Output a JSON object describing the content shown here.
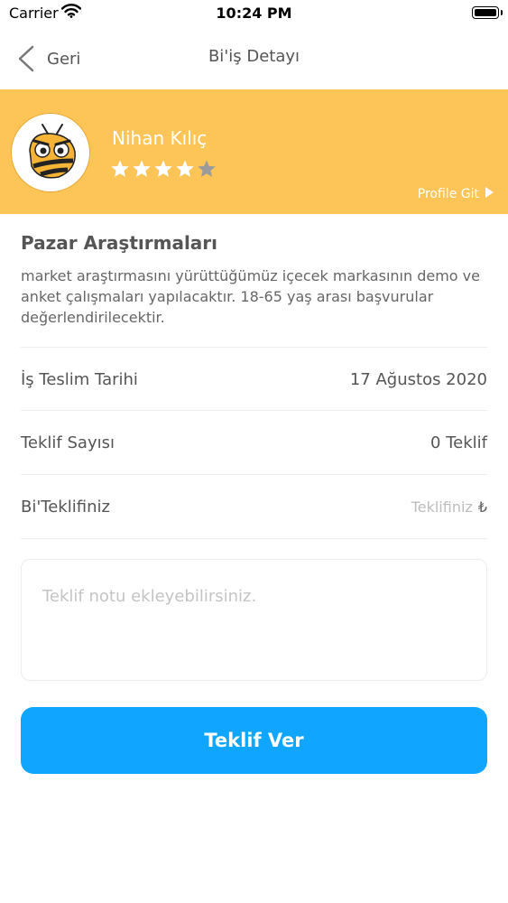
{
  "status_bar": {
    "carrier": "Carrier",
    "time": "10:24 PM"
  },
  "nav": {
    "back_label": "Geri",
    "title": "Bi'iş Detayı"
  },
  "profile": {
    "name": "Nihan Kılıç",
    "rating": 4,
    "rating_max": 5,
    "link_label": "Profile Git",
    "banner_color": "#FDC457"
  },
  "job": {
    "title": "Pazar Araştırmaları",
    "description": "market araştırmasını yürüttüğümüz içecek markasının demo ve anket çalışmaları yapılacaktır. 18-65 yaş arası başvurular değerlendirilecektir."
  },
  "details": {
    "delivery_label": "İş Teslim Tarihi",
    "delivery_value": "17 Ağustos 2020",
    "offers_label": "Teklif Sayısı",
    "offers_value": "0 Teklif",
    "your_offer_label": "Bi'Teklifiniz",
    "your_offer_placeholder": "Teklifiniz",
    "currency": "₺"
  },
  "note": {
    "placeholder": "Teklif notu ekleyebilirsiniz."
  },
  "submit": {
    "label": "Teklif Ver",
    "color": "#10A6FF"
  }
}
